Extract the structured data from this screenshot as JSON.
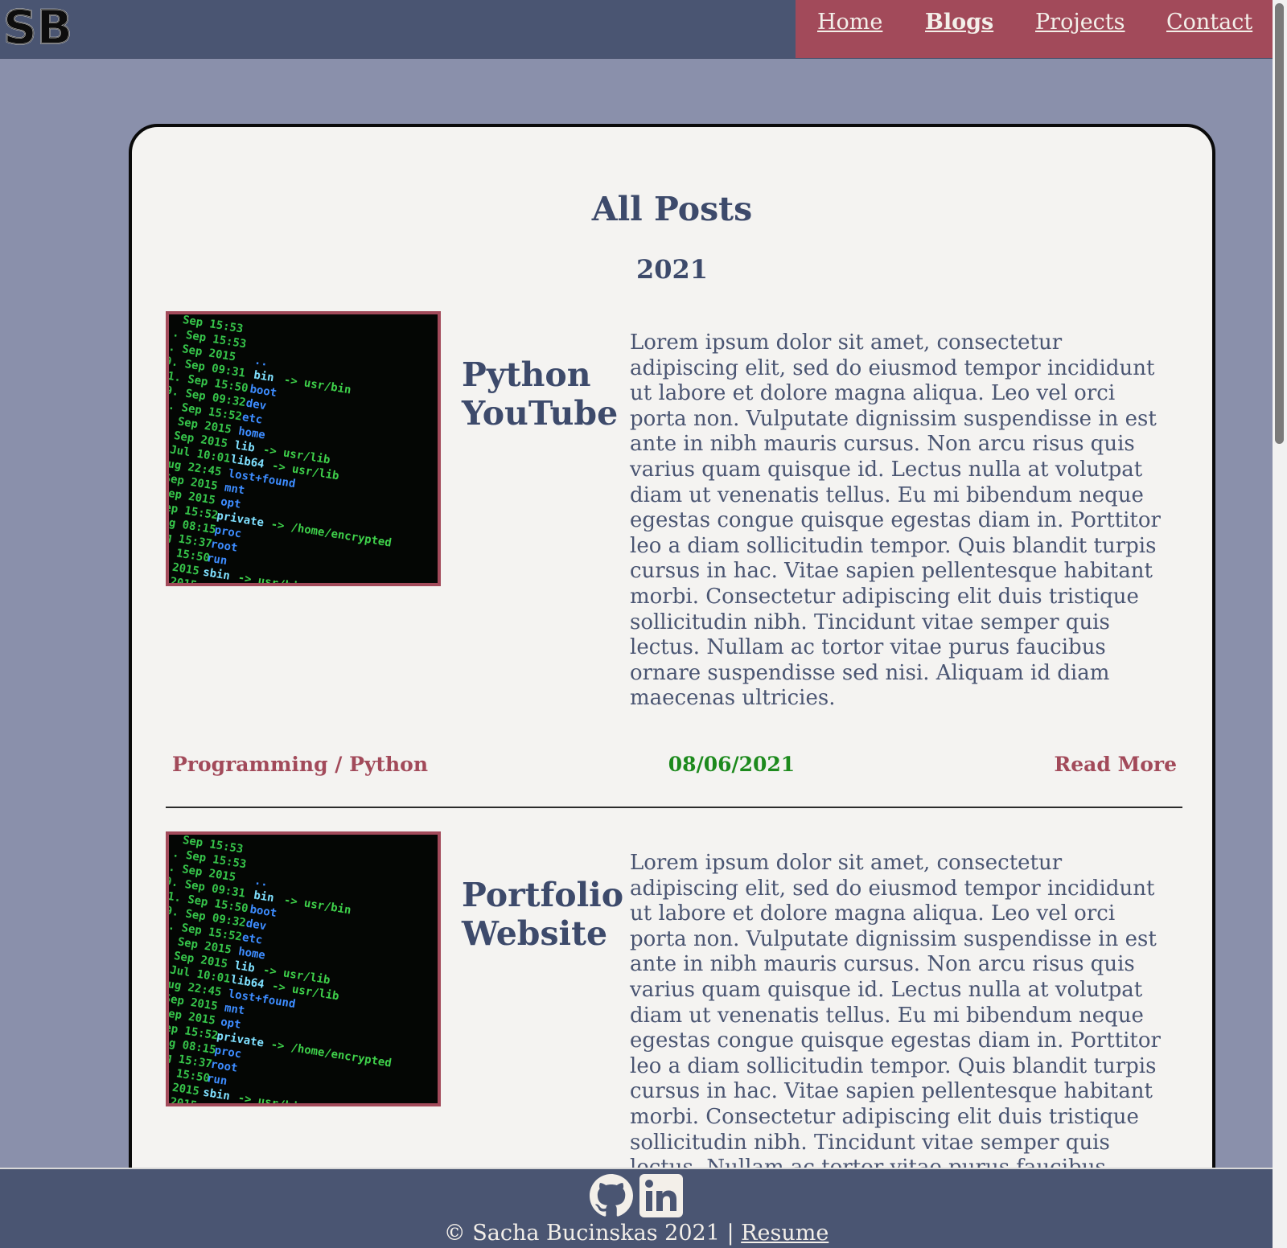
{
  "logo": {
    "text": "SB"
  },
  "nav": {
    "items": [
      {
        "label": "Home",
        "active": false
      },
      {
        "label": "Blogs",
        "active": true
      },
      {
        "label": "Projects",
        "active": false
      },
      {
        "label": "Contact",
        "active": false
      }
    ]
  },
  "main": {
    "title": "All Posts",
    "year": "2021",
    "posts": [
      {
        "title_line1": "Python",
        "title_line2": "YouTube",
        "body": "Lorem ipsum dolor sit amet, consectetur adipiscing elit, sed do eiusmod tempor incididunt ut labore et dolore magna aliqua. Leo vel orci porta non. Vulputate dignissim suspendisse in est ante in nibh mauris cursus. Non arcu risus quis varius quam quisque id. Lectus nulla at volutpat diam ut venenatis tellus. Eu mi bibendum neque egestas congue quisque egestas diam in. Porttitor leo a diam sollicitudin tempor. Quis blandit turpis cursus in hac. Vitae sapien pellentesque habitant morbi. Consectetur adipiscing elit duis tristique sollicitudin nibh. Tincidunt vitae semper quis lectus. Nullam ac tortor vitae purus faucibus ornare suspendisse sed nisi. Aliquam id diam maecenas ultricies.",
        "category": "Programming / Python",
        "date": "08/06/2021",
        "read_more": "Read More"
      },
      {
        "title_line1": "Portfolio",
        "title_line2": "Website",
        "body": "Lorem ipsum dolor sit amet, consectetur adipiscing elit, sed do eiusmod tempor incididunt ut labore et dolore magna aliqua. Leo vel orci porta non. Vulputate dignissim suspendisse in est ante in nibh mauris cursus. Non arcu risus quis varius quam quisque id. Lectus nulla at volutpat diam ut venenatis tellus. Eu mi bibendum neque egestas congue quisque egestas diam in. Porttitor leo a diam sollicitudin tempor. Quis blandit turpis cursus in hac. Vitae sapien pellentesque habitant morbi. Consectetur adipiscing elit duis tristique sollicitudin nibh. Tincidunt vitae semper quis lectus. Nullam ac tortor vitae purus faucibus"
      }
    ]
  },
  "footer": {
    "copyright": "© Sacha Bucinskas 2021 | ",
    "resume_label": "Resume",
    "icons": [
      "github-icon",
      "linkedin-icon"
    ]
  },
  "colors": {
    "header_bg": "#4a5572",
    "nav_bg": "#a24a5a",
    "page_bg": "#8a90ab",
    "card_bg": "#f4f3f1",
    "accent": "#a24a5a",
    "date_green": "#1d8a1d",
    "text_primary": "#3d4a6b"
  }
}
